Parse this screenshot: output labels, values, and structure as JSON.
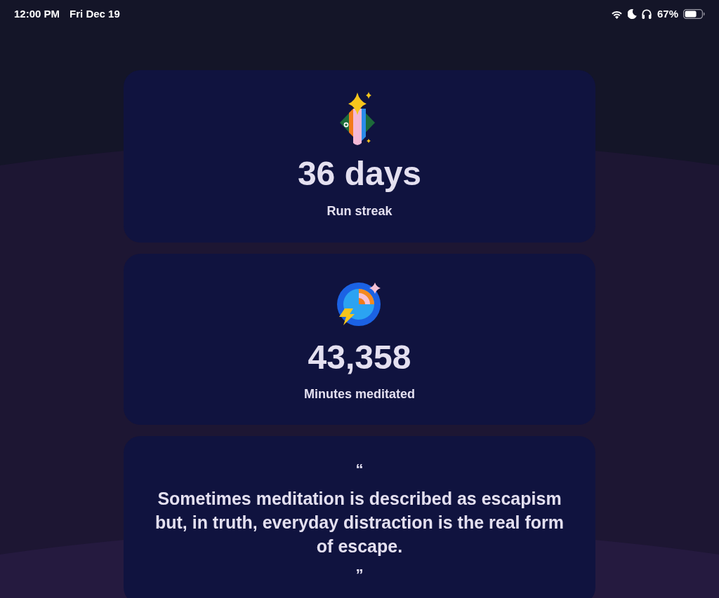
{
  "status_bar": {
    "time": "12:00 PM",
    "date": "Fri Dec 19",
    "battery_percent": "67%"
  },
  "stats": [
    {
      "kind": "streak",
      "value": "36 days",
      "label": "Run streak"
    },
    {
      "kind": "minutes",
      "value": "43,358",
      "label": "Minutes meditated"
    }
  ],
  "quote": {
    "open_mark": "“",
    "text": "Sometimes meditation is described as escapism\nbut, in truth, everyday distraction is the real form\nof escape.",
    "close_mark": "”"
  }
}
